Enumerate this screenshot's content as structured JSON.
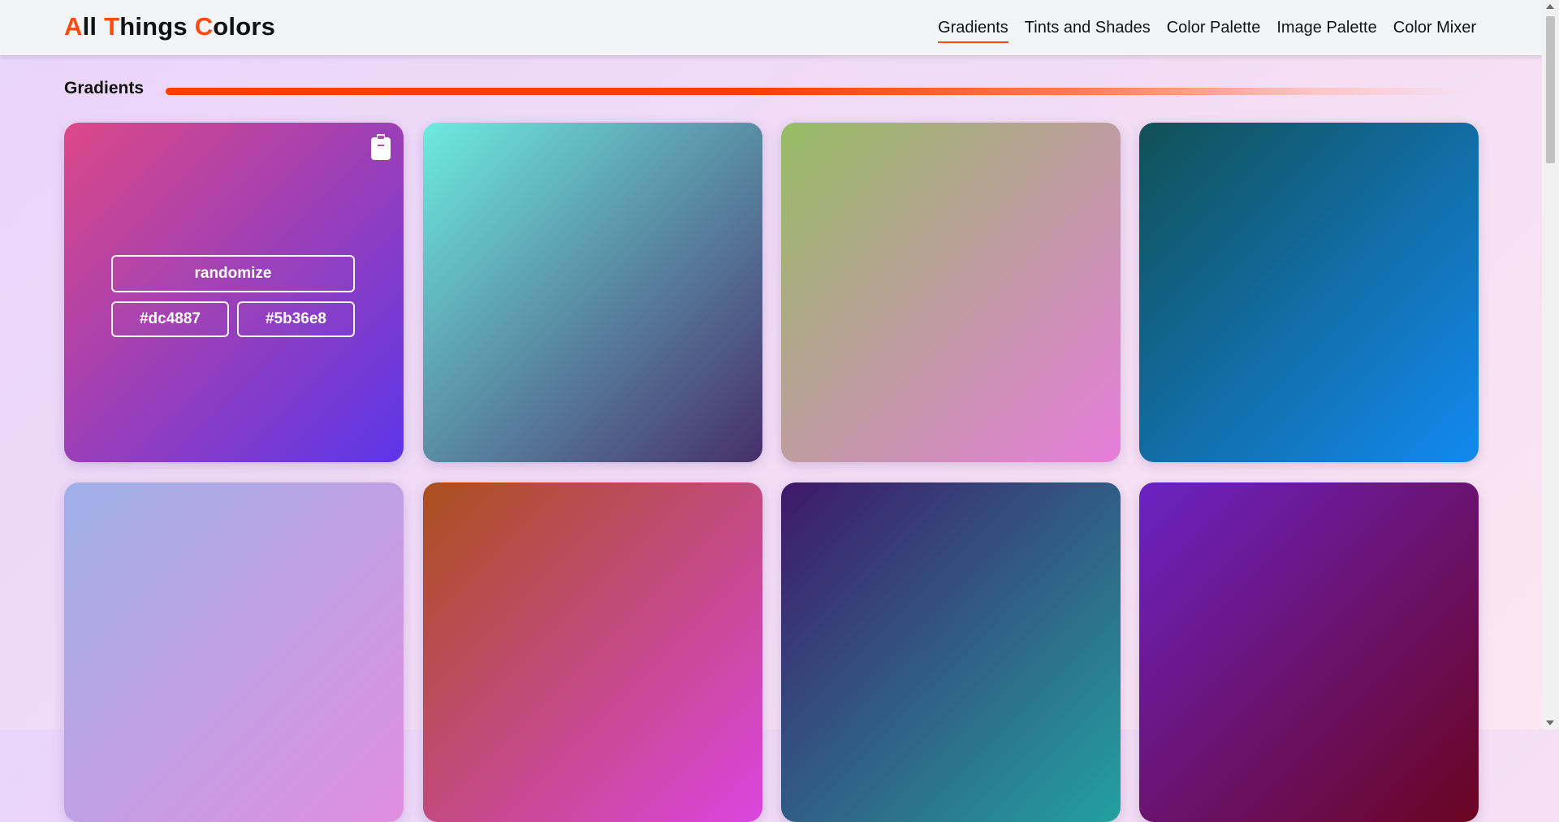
{
  "app": {
    "logo": {
      "w1_first": "A",
      "w1_rest": "ll",
      "w2_first": "T",
      "w2_rest": "hings",
      "w3_first": "C",
      "w3_rest": "olors"
    }
  },
  "nav": {
    "items": [
      {
        "label": "Gradients",
        "active": true
      },
      {
        "label": "Tints and Shades",
        "active": false
      },
      {
        "label": "Color Palette",
        "active": false
      },
      {
        "label": "Image Palette",
        "active": false
      },
      {
        "label": "Color Mixer",
        "active": false
      }
    ]
  },
  "section": {
    "title": "Gradients"
  },
  "cards": [
    {
      "from": "#dc4887",
      "to": "#5b36e8",
      "hovered": true,
      "randomize_label": "randomize",
      "color1_label": "#dc4887",
      "color2_label": "#5b36e8",
      "icon": "clipboard-icon"
    },
    {
      "from": "#6cebdf",
      "to": "#472f6b",
      "hovered": false
    },
    {
      "from": "#96bd63",
      "to": "#e77ddc",
      "hovered": false
    },
    {
      "from": "#115056",
      "to": "#1289f0",
      "hovered": false
    },
    {
      "from": "#9fb1e8",
      "to": "#e08ee0",
      "hovered": false
    },
    {
      "from": "#ab4f1c",
      "to": "#db45df",
      "hovered": false
    },
    {
      "from": "#3f1869",
      "to": "#22a1a0",
      "hovered": false
    },
    {
      "from": "#6b22c3",
      "to": "#6a0420",
      "hovered": false
    }
  ],
  "colors": {
    "accent": "#ff4a0f",
    "topbar": "#f3f4f6"
  }
}
